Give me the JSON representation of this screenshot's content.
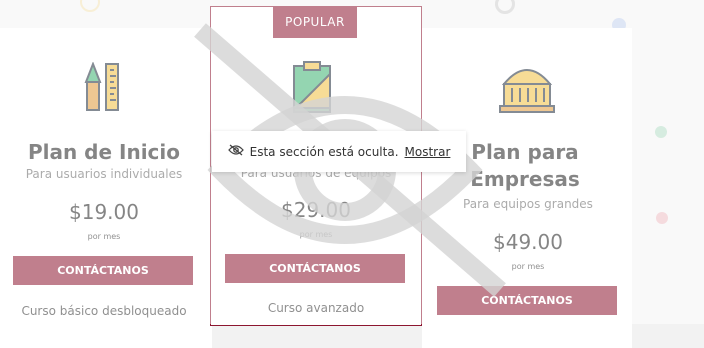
{
  "badge": {
    "label": "POPULAR"
  },
  "plans": [
    {
      "title": "Plan de Inicio",
      "subtitle": "Para usuarios individuales",
      "price": "$19.00",
      "period": "por mes",
      "cta": "CONTÁCTANOS",
      "description": "Curso básico desbloqueado"
    },
    {
      "title": "",
      "subtitle": "Para usuarios de equipos",
      "price": "$29.00",
      "period": "por mes",
      "cta": "CONTÁCTANOS",
      "description": "Curso avanzado"
    },
    {
      "title": "Plan para Empresas",
      "subtitle": "Para equipos grandes",
      "price": "$49.00",
      "period": "por mes",
      "cta": "CONTÁCTANOS",
      "description": ""
    }
  ],
  "notice": {
    "text": "Esta sección está oculta.",
    "link": "Mostrar"
  },
  "colors": {
    "brand": "#8d1630",
    "overlay": "#ffffff"
  },
  "icons": [
    "pen-ruler-icon",
    "clipboard-ruler-icon",
    "building-icon",
    "eye-slash-icon"
  ]
}
